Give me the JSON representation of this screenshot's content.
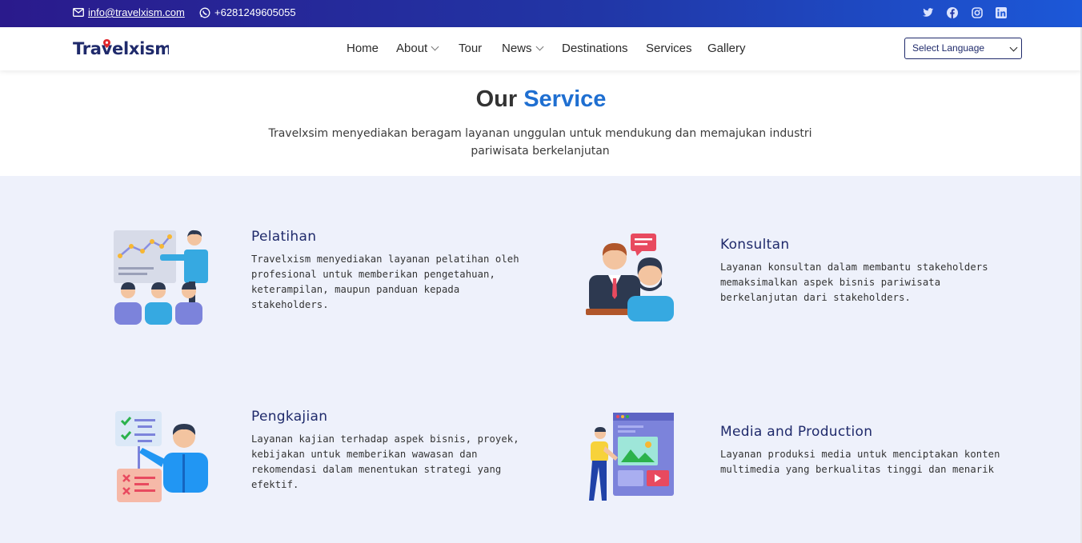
{
  "topbar": {
    "email": "info@travelxism.com",
    "phone": "+6281249605055",
    "social_icons": [
      "twitter-icon",
      "facebook-icon",
      "instagram-icon",
      "linkedin-icon"
    ]
  },
  "navbar": {
    "logo": "Travelxism",
    "items": [
      {
        "label": "Home",
        "dropdown": false
      },
      {
        "label": "About",
        "dropdown": true
      },
      {
        "label": "Tour",
        "dropdown": false
      },
      {
        "label": "News",
        "dropdown": true
      },
      {
        "label": "Destinations",
        "dropdown": false
      },
      {
        "label": "Services",
        "dropdown": false
      },
      {
        "label": "Gallery",
        "dropdown": false
      }
    ],
    "language_select": "Select Language"
  },
  "section": {
    "title_part1": "Our",
    "title_part2": "Service",
    "subtitle_line1": "Travelxsim menyediakan beragam layanan unggulan untuk mendukung dan memajukan industri",
    "subtitle_line2": "pariwisata berkelanjutan"
  },
  "services": [
    {
      "title": "Pelatihan",
      "lines": [
        "Travelxism menyediakan layanan pelatihan oleh",
        "profesional untuk memberikan pengetahuan,",
        "keterampilan, maupun panduan kepada",
        "stakeholders."
      ]
    },
    {
      "title": "Konsultan",
      "lines": [
        "Layanan konsultan dalam membantu stakeholders",
        "memaksimalkan aspek bisnis pariwisata",
        "berkelanjutan dari stakeholders."
      ]
    },
    {
      "title": "Pengkajian",
      "lines": [
        "Layanan kajian terhadap aspek bisnis, proyek,",
        "kebijakan untuk memberikan wawasan dan",
        "rekomendasi dalam menentukan strategi yang",
        "efektif."
      ]
    },
    {
      "title": "Media and Production",
      "lines": [
        "Layanan produksi media untuk menciptakan konten",
        "multimedia yang berkualitas tinggi dan menarik"
      ]
    }
  ],
  "colors": {
    "topbar_start": "#2a1a8c",
    "topbar_end": "#1c58d8",
    "accent": "#1f6fd1",
    "navy": "#1f2a6b",
    "services_bg": "#eef1fb"
  }
}
